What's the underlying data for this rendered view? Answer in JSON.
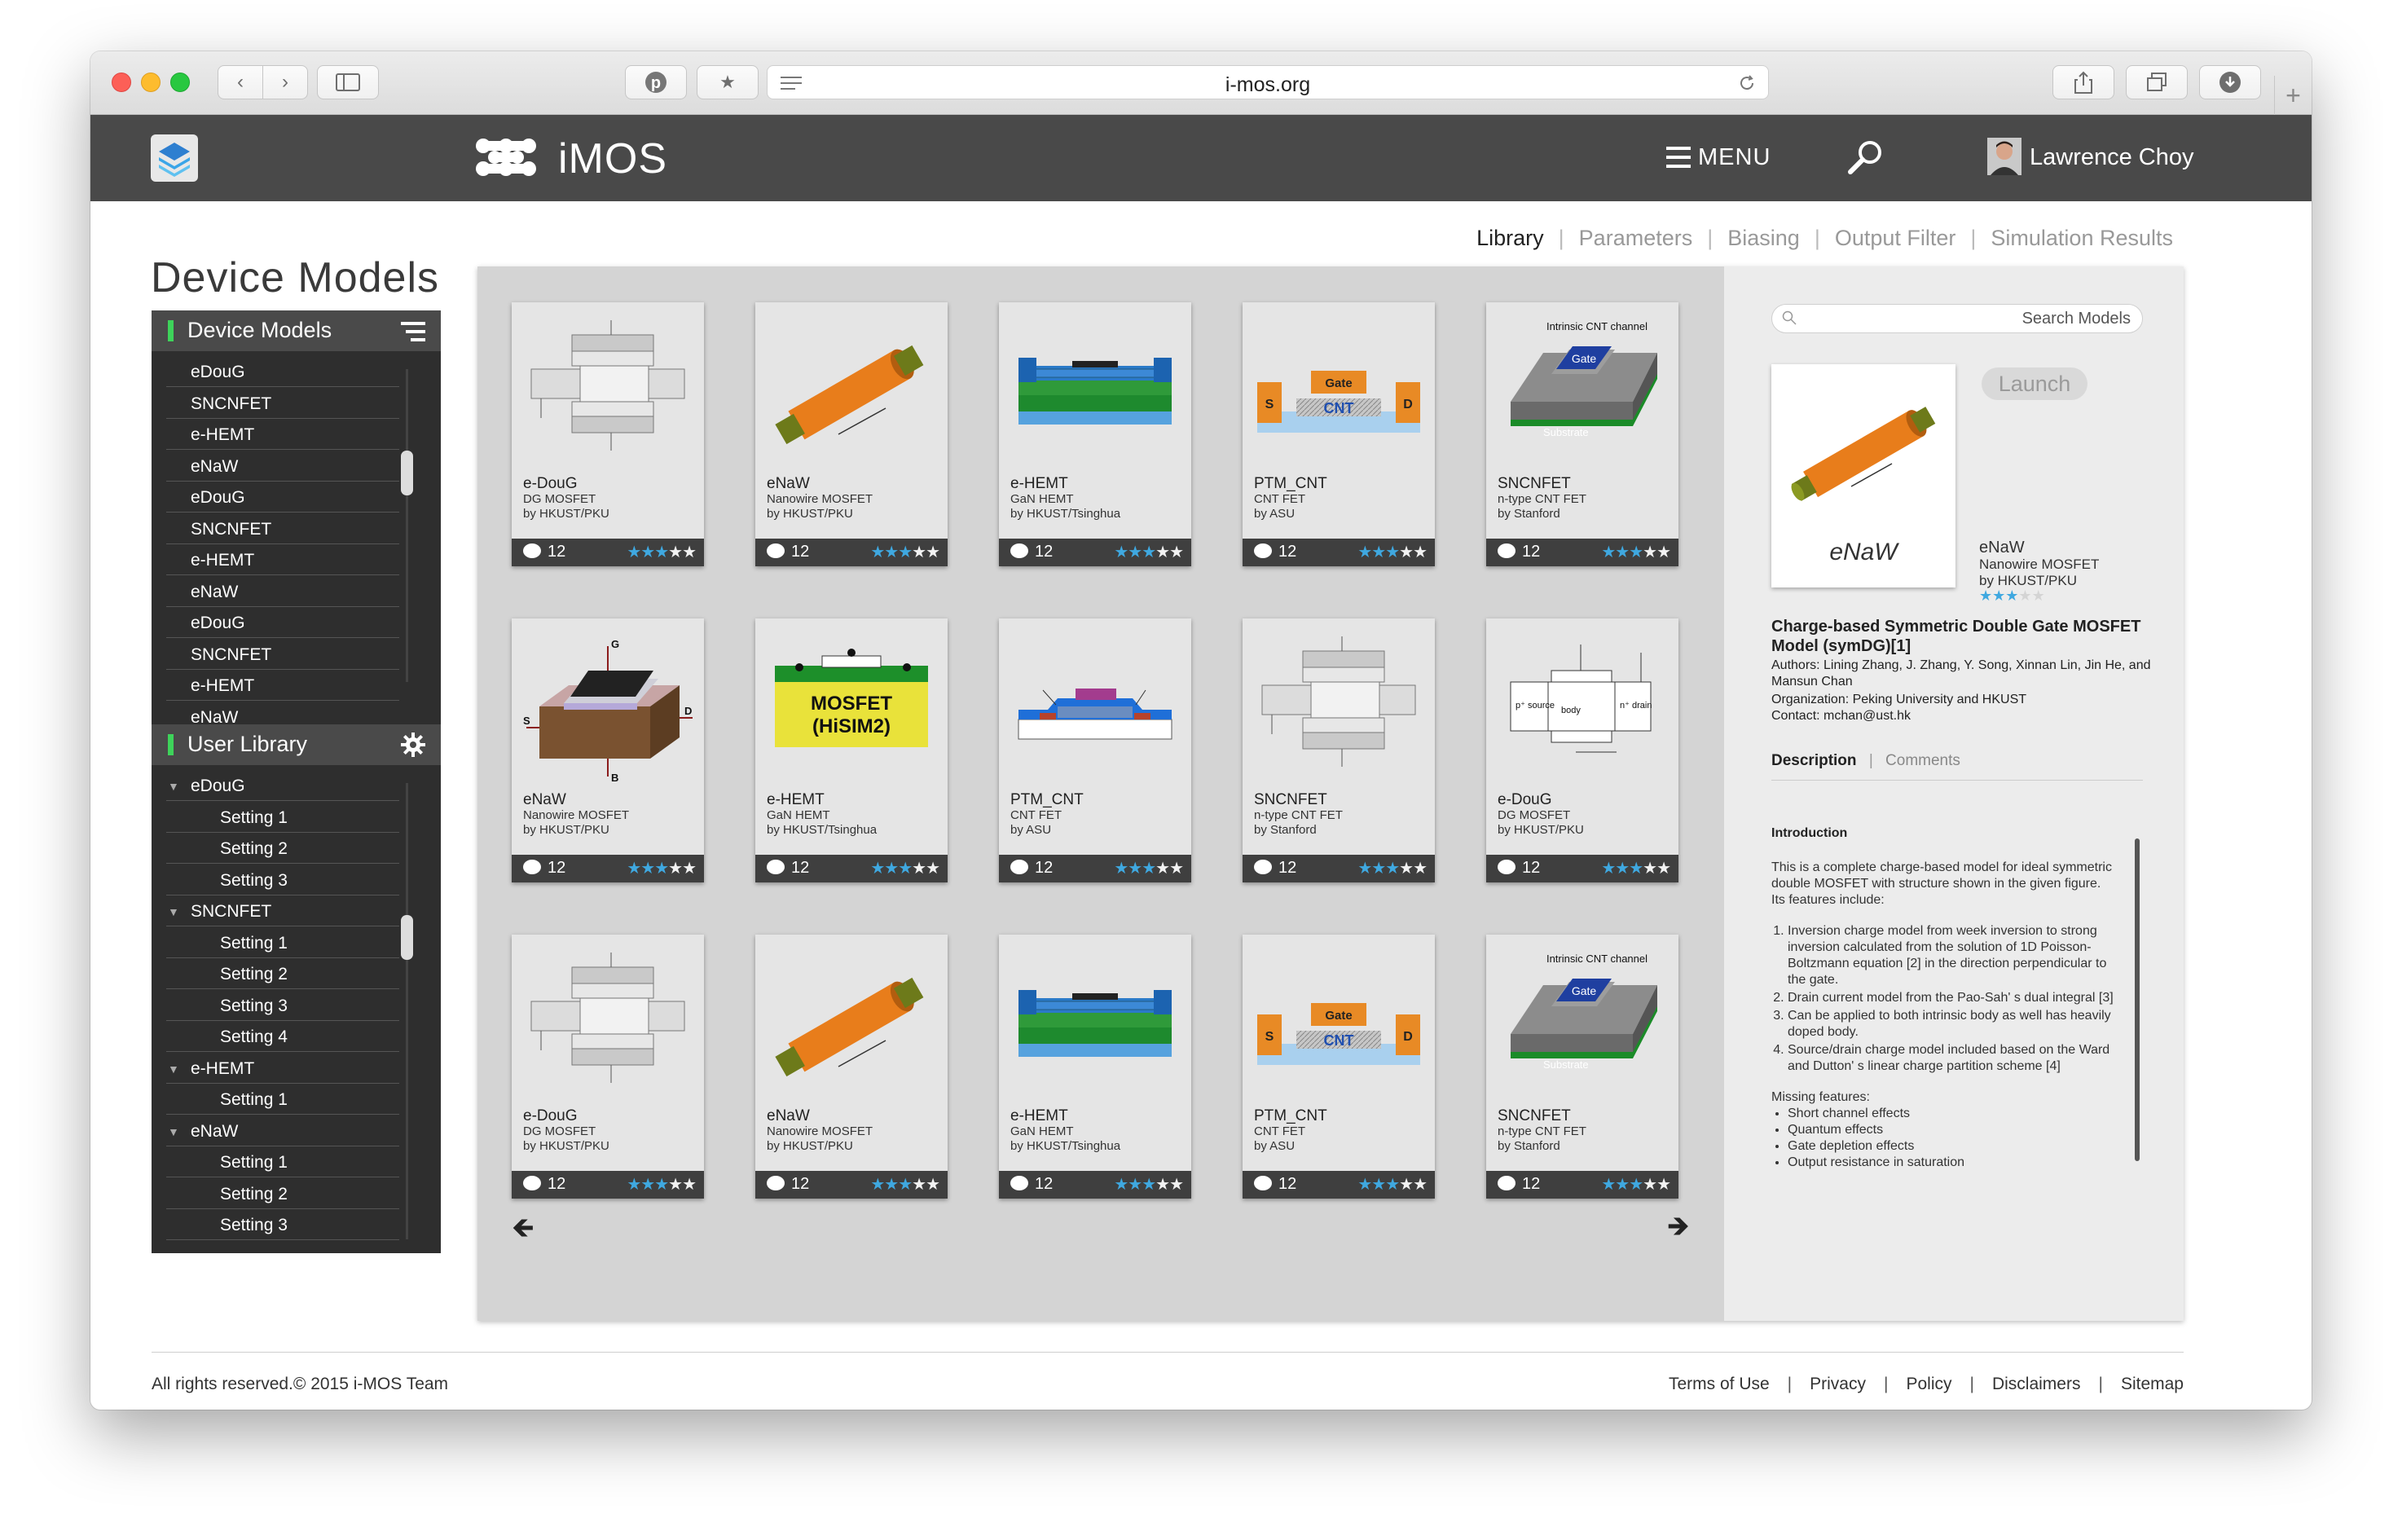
{
  "browser": {
    "url": "i-mos.org"
  },
  "header": {
    "app_name": "iMOS",
    "menu_label": "MENU",
    "user_name": "Lawrence Choy"
  },
  "nav_tabs": [
    {
      "label": "Library"
    },
    {
      "label": "Parameters"
    },
    {
      "label": "Biasing"
    },
    {
      "label": "Output Filter"
    },
    {
      "label": "Simulation Results"
    }
  ],
  "page_title": "Device Models",
  "sidebar": {
    "device_models": {
      "title": "Device Models",
      "items": [
        "eDouG",
        "SNCNFET",
        "e-HEMT",
        "eNaW",
        "eDouG",
        "SNCNFET",
        "e-HEMT",
        "eNaW",
        "eDouG",
        "SNCNFET",
        "e-HEMT",
        "eNaW"
      ]
    },
    "user_library": {
      "title": "User Library",
      "groups": [
        {
          "name": "eDouG",
          "settings": [
            "Setting 1",
            "Setting 2",
            "Setting 3"
          ]
        },
        {
          "name": "SNCNFET",
          "settings": [
            "Setting 1",
            "Setting 2",
            "Setting 3",
            "Setting 4"
          ]
        },
        {
          "name": "e-HEMT",
          "settings": [
            "Setting 1"
          ]
        },
        {
          "name": "eNaW",
          "settings": [
            "Setting 1",
            "Setting 2",
            "Setting 3"
          ]
        }
      ]
    }
  },
  "cards": [
    {
      "name": "e-DouG",
      "type": "DG MOSFET",
      "org": "by HKUST/PKU",
      "comments": "12",
      "rating": 3,
      "art": "doug"
    },
    {
      "name": "eNaW",
      "type": "Nanowire MOSFET",
      "org": "by HKUST/PKU",
      "comments": "12",
      "rating": 3,
      "art": "naw"
    },
    {
      "name": "e-HEMT",
      "type": "GaN HEMT",
      "org": "by HKUST/Tsinghua",
      "comments": "12",
      "rating": 3,
      "art": "hemt"
    },
    {
      "name": "PTM_CNT",
      "type": "CNT FET",
      "org": "by ASU",
      "comments": "12",
      "rating": 3,
      "art": "cnt"
    },
    {
      "name": "SNCNFET",
      "type": "n-type CNT FET",
      "org": "by Stanford",
      "comments": "12",
      "rating": 3,
      "art": "sncn"
    },
    {
      "name": "eNaW",
      "type": "Nanowire MOSFET",
      "org": "by HKUST/PKU",
      "comments": "12",
      "rating": 3,
      "art": "box3d"
    },
    {
      "name": "e-HEMT",
      "type": "GaN HEMT",
      "org": "by HKUST/Tsinghua",
      "comments": "12",
      "rating": 3,
      "art": "hisim"
    },
    {
      "name": "PTM_CNT",
      "type": "CNT FET",
      "org": "by ASU",
      "comments": "12",
      "rating": 3,
      "art": "ptm"
    },
    {
      "name": "SNCNFET",
      "type": "n-type CNT FET",
      "org": "by Stanford",
      "comments": "12",
      "rating": 3,
      "art": "doug"
    },
    {
      "name": "e-DouG",
      "type": "DG MOSFET",
      "org": "by HKUST/PKU",
      "comments": "12",
      "rating": 3,
      "art": "dg"
    },
    {
      "name": "e-DouG",
      "type": "DG MOSFET",
      "org": "by HKUST/PKU",
      "comments": "12",
      "rating": 3,
      "art": "doug"
    },
    {
      "name": "eNaW",
      "type": "Nanowire MOSFET",
      "org": "by HKUST/PKU",
      "comments": "12",
      "rating": 3,
      "art": "naw"
    },
    {
      "name": "e-HEMT",
      "type": "GaN HEMT",
      "org": "by HKUST/Tsinghua",
      "comments": "12",
      "rating": 3,
      "art": "hemt"
    },
    {
      "name": "PTM_CNT",
      "type": "CNT FET",
      "org": "by ASU",
      "comments": "12",
      "rating": 3,
      "art": "cnt"
    },
    {
      "name": "SNCNFET",
      "type": "n-type CNT FET",
      "org": "by Stanford",
      "comments": "12",
      "rating": 3,
      "art": "sncn"
    }
  ],
  "art_labels": {
    "gate": "Gate",
    "cnt": "CNT",
    "s": "S",
    "d": "D",
    "intrinsic": "Intrinsic CNT channel",
    "substrate": "Substrate",
    "mosfet": "MOSFET",
    "hisim": "(HiSIM2)",
    "g": "G",
    "b": "B",
    "p_source": "p⁺ source",
    "body": "body",
    "n_drain": "n⁺ drain"
  },
  "detail": {
    "search_placeholder": "Search Models",
    "launch_label": "Launch",
    "thumb_name": "eNaW",
    "name": "eNaW",
    "type": "Nanowire MOSFET",
    "org": "by HKUST/PKU",
    "rating": 3,
    "title": "Charge-based Symmetric Double Gate MOSFET Model (symDG)[1]",
    "authors": "Authors: Lining Zhang, J. Zhang, Y. Song, Xinnan Lin, Jin He, and Mansun Chan",
    "organization": "Organization: Peking University and HKUST",
    "contact": "Contact: mchan@ust.hk",
    "tabs": [
      "Description",
      "Comments"
    ],
    "intro_heading": "Introduction",
    "intro_text": "This is a complete charge-based model for ideal symmetric double MOSFET with structure shown in the given figure. Its features include:",
    "features": [
      "Inversion charge model from week inversion to strong inversion calculated from the solution of 1D Poisson-Boltzmann equation [2] in the direction perpendicular to the gate.",
      "Drain current model from the Pao-Sah' s dual integral [3]",
      "Can be applied to both intrinsic body as well has heavily doped body.",
      "Source/drain charge model included based on the Ward and Dutton' s linear charge partition scheme [4]"
    ],
    "missing_heading": "Missing features:",
    "missing": [
      "Short channel effects",
      "Quantum effects",
      "Gate depletion effects",
      "Output resistance in saturation"
    ]
  },
  "footer": {
    "copyright": "All rights reserved.© 2015 i-MOS Team",
    "links": [
      "Terms of Use",
      "Privacy",
      "Policy",
      "Disclaimers",
      "Sitemap"
    ]
  },
  "colors": {
    "header_bg": "#494949",
    "accent_green": "#3ed35a",
    "star_blue": "#3fa8e0",
    "sidebar_bg": "#2e2e2e"
  }
}
